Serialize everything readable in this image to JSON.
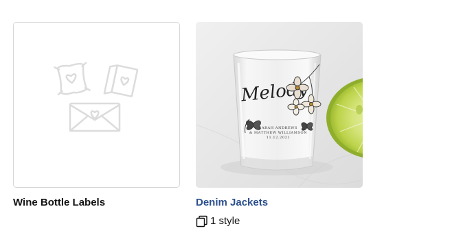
{
  "cards": [
    {
      "title": "Wine Bottle Labels",
      "placeholder_icons": [
        "pillow-icon",
        "greeting-card-icon",
        "envelope-heart-icon"
      ]
    },
    {
      "title": "Denim Jackets",
      "styles_label": "1 style",
      "styles_icon": "stacked-pages-icon",
      "product_text": {
        "script_name": "Melody",
        "line1": "SARAH ANDREWS",
        "line2": "& MATTHEW WILLIAMSON",
        "line3": "11.12.2021"
      }
    }
  ],
  "colors": {
    "link": "#2c4f8c",
    "text": "#111111",
    "placeholder_stroke": "#dcdcdc",
    "border": "#d6d6d6",
    "lime": "#c6dc5c"
  }
}
